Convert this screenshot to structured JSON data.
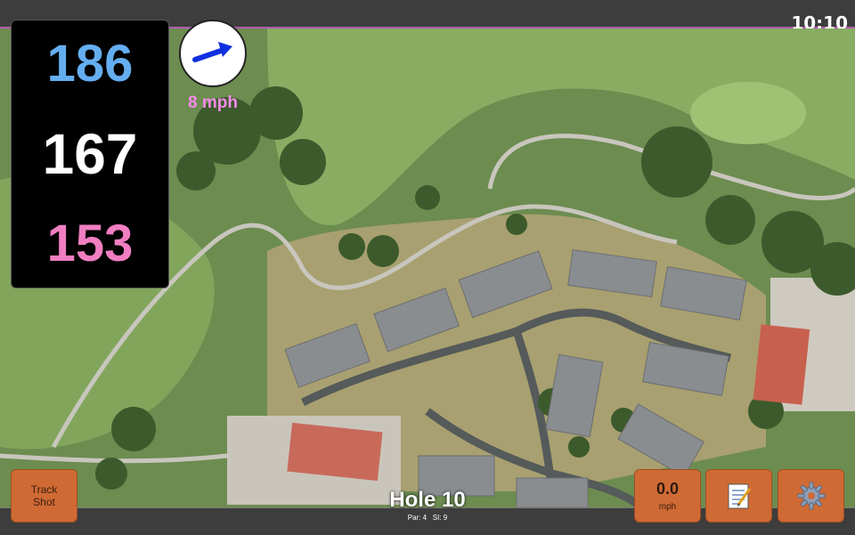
{
  "status": {
    "time": "10:10"
  },
  "distances": {
    "back": "186",
    "middle": "167",
    "front": "153"
  },
  "wind": {
    "speed": "8 mph",
    "icon": "wind-direction-arrow-icon"
  },
  "hole": {
    "title": "Hole 10",
    "par_label": "Par: 4",
    "si_label": "SI: 9"
  },
  "buttons": {
    "track_shot_line1": "Track",
    "track_shot_line2": "Shot",
    "speed_value": "0.0",
    "speed_unit": "mph",
    "notes_icon": "notepad-icon",
    "settings_icon": "gear-icon"
  },
  "colors": {
    "back_distance": "#64aef0",
    "middle_distance": "#ffffff",
    "front_distance": "#f07ec0",
    "wind_text": "#f58ae8",
    "button": "#d06a34",
    "accent_border": "#b05ab0"
  }
}
